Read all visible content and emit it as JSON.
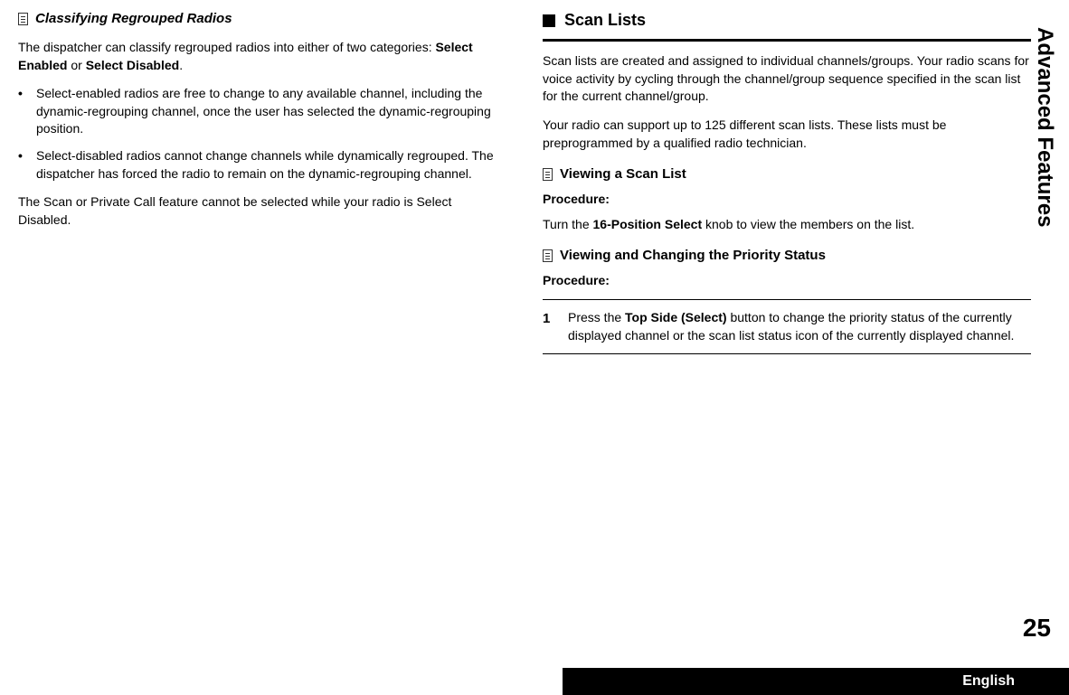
{
  "sideLabel": "Advanced Features",
  "pageNumber": "25",
  "language": "English",
  "leftColumn": {
    "title": "Classifying Regrouped Radios",
    "intro": {
      "pre": "The dispatcher can classify regrouped radios into either of two categories: ",
      "bold1": "Select Enabled",
      "mid": " or ",
      "bold2": "Select Disabled",
      "post": "."
    },
    "bullets": [
      "Select-enabled radios are free to change to any available channel, including the dynamic-regrouping channel, once the user has selected the dynamic-regrouping position.",
      "Select-disabled radios cannot change channels while dynamically regrouped. The dispatcher has forced the radio to remain on the dynamic-regrouping channel."
    ],
    "closing": "The Scan or Private Call feature cannot be selected while your radio is Select Disabled."
  },
  "rightColumn": {
    "sectionTitle": "Scan Lists",
    "para1": "Scan lists are created and assigned to individual channels/groups. Your radio scans for voice activity by cycling through the channel/group sequence specified in the scan list for the current channel/group.",
    "para2": "Your radio can support up to 125 different scan lists. These lists must be preprogrammed by a qualified radio technician.",
    "sub1": {
      "title": "Viewing a Scan List",
      "procedureLabel": "Procedure:",
      "text": {
        "pre": "Turn the ",
        "bold": "16-Position Select",
        "post": " knob to view the members on the list."
      }
    },
    "sub2": {
      "title": "Viewing and Changing the Priority Status",
      "procedureLabel": "Procedure:",
      "step1": {
        "num": "1",
        "pre": "Press the ",
        "bold": "Top Side (Select)",
        "post": " button to change the priority status of the currently displayed channel or the scan list status icon of the currently displayed channel."
      }
    }
  }
}
